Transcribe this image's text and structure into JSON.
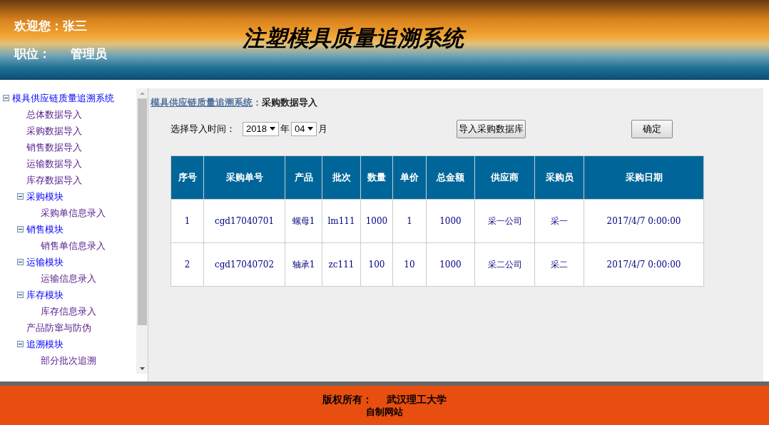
{
  "header": {
    "welcome_label": "欢迎您：",
    "user_name": "张三",
    "role_label": "职位：",
    "role": "管理员",
    "title": "注塑模具质量追溯系统"
  },
  "sidebar": {
    "tree": [
      {
        "label": "模具供应链质量追溯系统",
        "expanded": true,
        "children": [
          {
            "label": "总体数据导入"
          },
          {
            "label": "采购数据导入"
          },
          {
            "label": "销售数据导入"
          },
          {
            "label": "运输数据导入"
          },
          {
            "label": "库存数据导入"
          },
          {
            "label": "采购模块",
            "expanded": true,
            "children": [
              {
                "label": "采购单信息录入"
              }
            ]
          },
          {
            "label": "销售模块",
            "expanded": true,
            "children": [
              {
                "label": "销售单信息录入"
              }
            ]
          },
          {
            "label": "运输模块",
            "expanded": true,
            "children": [
              {
                "label": "运输信息录入"
              }
            ]
          },
          {
            "label": "库存模块",
            "expanded": true,
            "children": [
              {
                "label": "库存信息录入"
              }
            ]
          },
          {
            "label": "产品防窜与防伪"
          },
          {
            "label": "追溯模块",
            "expanded": true,
            "children": [
              {
                "label": "部分批次追溯"
              }
            ]
          }
        ]
      }
    ]
  },
  "breadcrumb": {
    "link": "模具供应链质量追溯系统",
    "separator": "：",
    "current": "采购数据导入"
  },
  "filter": {
    "label": "选择导入时间：",
    "year": "2018",
    "year_unit": "年",
    "month": "04",
    "month_unit": "月"
  },
  "buttons": [
    {
      "label": "导入采购数据库"
    },
    {
      "label": "确定"
    }
  ],
  "table": {
    "columns": [
      "序号",
      "采购单号",
      "产品",
      "批次",
      "数量",
      "单价",
      "总金额",
      "供应商",
      "采购员",
      "采购日期"
    ],
    "rows": [
      [
        "1",
        "cgd17040701",
        "螺母1",
        "lm111",
        "1000",
        "1",
        "1000",
        "采一公司",
        "采一",
        "2017/4/7 0:00:00"
      ],
      [
        "2",
        "cgd17040702",
        "轴承1",
        "zc111",
        "100",
        "10",
        "1000",
        "采二公司",
        "采二",
        "2017/4/7 0:00:00"
      ]
    ]
  },
  "footer": {
    "copyright_label": "版权所有：",
    "owner": "武汉理工大学",
    "note": "自制网站"
  }
}
